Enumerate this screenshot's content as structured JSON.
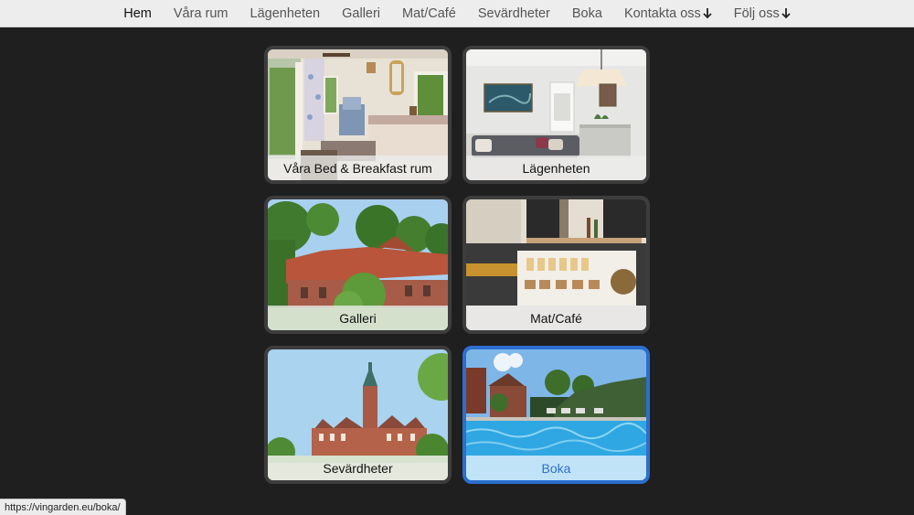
{
  "nav": {
    "items": [
      {
        "label": "Hem",
        "active": true
      },
      {
        "label": "Våra rum"
      },
      {
        "label": "Lägenheten"
      },
      {
        "label": "Galleri"
      },
      {
        "label": "Mat/Café"
      },
      {
        "label": "Sevärdheter"
      },
      {
        "label": "Boka"
      },
      {
        "label": "Kontakta oss",
        "icon": "arrow-down-icon"
      },
      {
        "label": "Följ oss",
        "icon": "arrow-down-icon"
      }
    ]
  },
  "tiles": [
    {
      "label": "Våra Bed & Breakfast rum",
      "image": "bedroom-photo"
    },
    {
      "label": "Lägenheten",
      "image": "apartment-living-room-photo"
    },
    {
      "label": "Galleri",
      "image": "brick-house-photo"
    },
    {
      "label": "Mat/Café",
      "image": "cafe-counter-photo"
    },
    {
      "label": "Sevärdheter",
      "image": "castle-photo"
    },
    {
      "label": "Boka",
      "image": "pool-photo",
      "hovered": true
    }
  ],
  "colors": {
    "background": "#1f1f1f",
    "accent": "#2c6fcf",
    "nav_bg": "#ededed"
  },
  "status_bar": {
    "url": "https://vingarden.eu/boka/"
  }
}
